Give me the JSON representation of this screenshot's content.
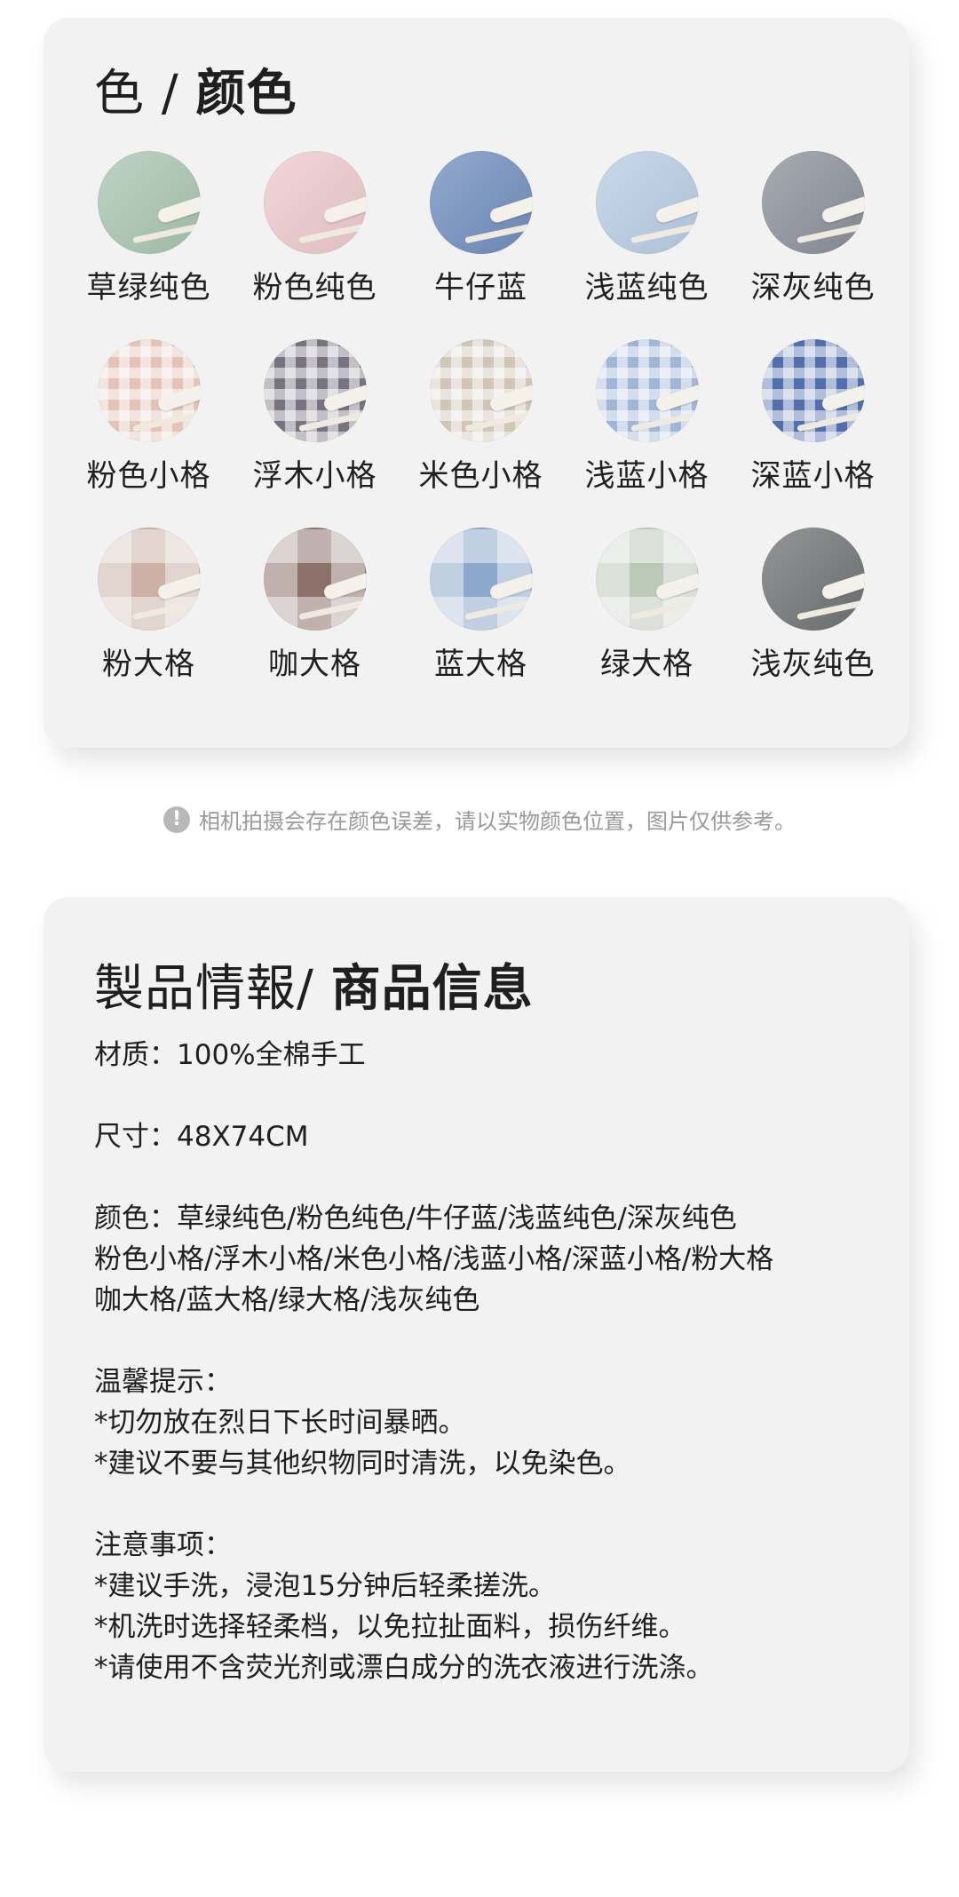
{
  "color_section": {
    "title_prefix": "色 / ",
    "title_main": "颜色",
    "swatches": [
      {
        "label": "草绿纯色",
        "color": "#a8c4b0",
        "style": "solid"
      },
      {
        "label": "粉色纯色",
        "color": "#ecc9cd",
        "style": "solid"
      },
      {
        "label": "牛仔蓝",
        "color": "#6f8dbd",
        "style": "solid"
      },
      {
        "label": "浅蓝纯色",
        "color": "#b7cce4",
        "style": "solid"
      },
      {
        "label": "深灰纯色",
        "color": "#8a8f98",
        "style": "solid"
      },
      {
        "label": "粉色小格",
        "color": "#e3c4b6",
        "style": "gingham"
      },
      {
        "label": "浮木小格",
        "color": "#777480",
        "style": "gingham"
      },
      {
        "label": "米色小格",
        "color": "#cfc6b5",
        "style": "gingham"
      },
      {
        "label": "浅蓝小格",
        "color": "#9fb7d6",
        "style": "gingham"
      },
      {
        "label": "深蓝小格",
        "color": "#4f6fae",
        "style": "gingham"
      },
      {
        "label": "粉大格",
        "color": "#cbb1a6",
        "style": "plaid"
      },
      {
        "label": "咖大格",
        "color": "#8c716b",
        "style": "plaid"
      },
      {
        "label": "蓝大格",
        "color": "#8ea8cc",
        "style": "plaid"
      },
      {
        "label": "绿大格",
        "color": "#bdc9b8",
        "style": "plaid"
      },
      {
        "label": "浅灰纯色",
        "color": "#6f7274",
        "style": "solid"
      }
    ]
  },
  "notice": {
    "icon": "exclamation-icon",
    "text": "相机拍摄会存在颜色误差，请以实物颜色位置，图片仅供参考。"
  },
  "info_section": {
    "title_prefix": "製品情報/ ",
    "title_main": "商品信息",
    "paragraphs": [
      [
        "材质：100%全棉手工"
      ],
      [
        "尺寸：48X74CM"
      ],
      [
        "颜色：草绿纯色/粉色纯色/牛仔蓝/浅蓝纯色/深灰纯色",
        "粉色小格/浮木小格/米色小格/浅蓝小格/深蓝小格/粉大格",
        "咖大格/蓝大格/绿大格/浅灰纯色"
      ],
      [
        "温馨提示：",
        "*切勿放在烈日下长时间暴晒。",
        "*建议不要与其他织物同时清洗，以免染色。"
      ],
      [
        "注意事项：",
        "*建议手洗，浸泡15分钟后轻柔搓洗。",
        "*机洗时选择轻柔档，以免拉扯面料，损伤纤维。",
        "*请使用不含荧光剂或漂白成分的洗衣液进行洗涤。"
      ]
    ]
  }
}
